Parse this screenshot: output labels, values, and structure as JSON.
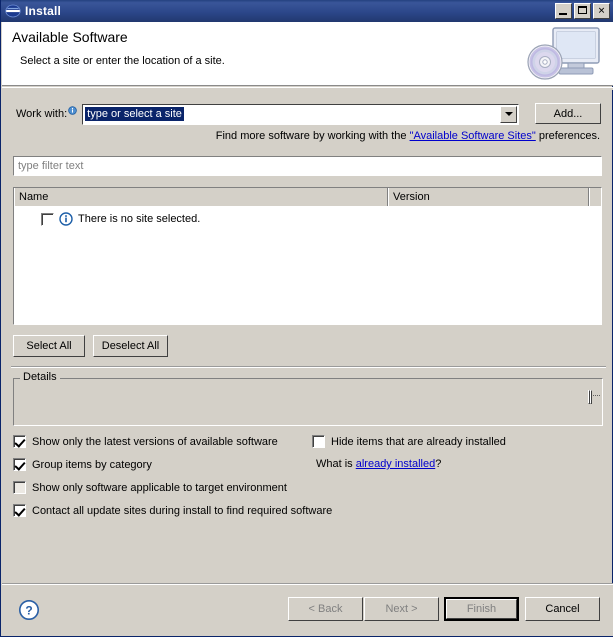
{
  "window": {
    "title": "Install",
    "icon": "eclipse-icon",
    "controls": {
      "minimize": "Minimize",
      "maximize": "Maximize",
      "close": "Close"
    }
  },
  "banner": {
    "title": "Available Software",
    "subtitle": "Select a site or enter the location of a site.",
    "art": "monitor-cd-icon"
  },
  "work_with": {
    "label": "Work with:",
    "info_icon": "info-icon",
    "value": "type or select a site",
    "placeholder": "type or select a site",
    "dropdown_icon": "chevron-down-icon",
    "add_button": "Add..."
  },
  "find_line": {
    "prefix": "Find more software by working with the ",
    "link": "\"Available Software Sites\"",
    "suffix": " preferences."
  },
  "filter": {
    "placeholder": "type filter text",
    "value": ""
  },
  "tree": {
    "columns": [
      "Name",
      "Version"
    ],
    "rows": [
      {
        "checked": false,
        "icon": "info-icon",
        "name": "There is no site selected.",
        "version": ""
      }
    ]
  },
  "selection_buttons": {
    "select_all": "Select All",
    "deselect_all": "Deselect All"
  },
  "details": {
    "legend": "Details",
    "content": "",
    "scroll_icon": "scrollbar-thumb"
  },
  "options": [
    {
      "label": "Show only the latest versions of available software",
      "checked": true,
      "enabled": true
    },
    {
      "label": "Group items by category",
      "checked": true,
      "enabled": true
    },
    {
      "label": "Show only software applicable to target environment",
      "checked": false,
      "enabled": false
    },
    {
      "label": "Contact all update sites during install to find required software",
      "checked": true,
      "enabled": true
    }
  ],
  "options_right": [
    {
      "label": "Hide items that are already installed",
      "checked": false,
      "enabled": true
    }
  ],
  "what_is": {
    "prefix": "What is ",
    "link": "already installed",
    "suffix": "?"
  },
  "footer": {
    "help_icon": "help-icon",
    "buttons": [
      {
        "label": "< Back",
        "enabled": false,
        "default": false
      },
      {
        "label": "Next >",
        "enabled": false,
        "default": false
      },
      {
        "label": "Finish",
        "enabled": false,
        "default": true
      },
      {
        "label": "Cancel",
        "enabled": true,
        "default": false
      }
    ]
  },
  "colors": {
    "titlebar": "#2c478a",
    "dialog_bg": "#d4d0c8",
    "banner_bg": "#ffffff",
    "link": "#0000cc",
    "selection_bg": "#0a246a",
    "selection_fg": "#ffffff",
    "placeholder_fg": "#808080",
    "disabled_fg": "#808080"
  }
}
